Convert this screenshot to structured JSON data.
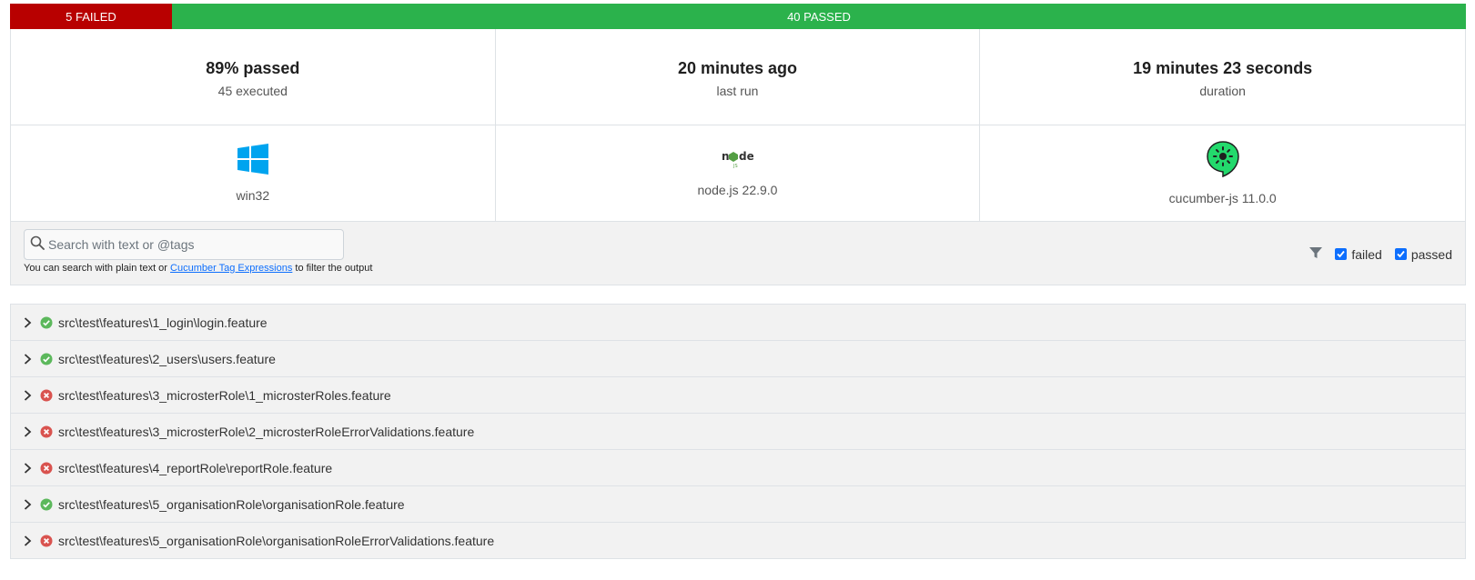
{
  "summary": {
    "failed_label": "5 FAILED",
    "passed_label": "40 PASSED",
    "failed_count": 5,
    "passed_count": 40,
    "failed_color": "#b80000",
    "passed_color": "#2bb24c"
  },
  "stats": [
    {
      "value": "89% passed",
      "label": "45 executed"
    },
    {
      "value": "20 minutes ago",
      "label": "last run"
    },
    {
      "value": "19 minutes 23 seconds",
      "label": "duration"
    }
  ],
  "environment": [
    {
      "icon": "windows-icon",
      "label": "win32"
    },
    {
      "icon": "nodejs-icon",
      "label": "node.js 22.9.0"
    },
    {
      "icon": "cucumber-icon",
      "label": "cucumber-js 11.0.0"
    }
  ],
  "search": {
    "placeholder": "Search with text or @tags",
    "value": "",
    "help_prefix": "You can search with plain text or ",
    "help_link": "Cucumber Tag Expressions",
    "help_suffix": " to filter the output"
  },
  "filters": {
    "icon": "filter-icon",
    "failed_label": "failed",
    "passed_label": "passed",
    "failed_checked": true,
    "passed_checked": true
  },
  "features": [
    {
      "path": "src\\test\\features\\1_login\\login.feature",
      "status": "passed"
    },
    {
      "path": "src\\test\\features\\2_users\\users.feature",
      "status": "passed"
    },
    {
      "path": "src\\test\\features\\3_microsterRole\\1_microsterRoles.feature",
      "status": "failed"
    },
    {
      "path": "src\\test\\features\\3_microsterRole\\2_microsterRoleErrorValidations.feature",
      "status": "failed"
    },
    {
      "path": "src\\test\\features\\4_reportRole\\reportRole.feature",
      "status": "failed"
    },
    {
      "path": "src\\test\\features\\5_organisationRole\\organisationRole.feature",
      "status": "passed"
    },
    {
      "path": "src\\test\\features\\5_organisationRole\\organisationRoleErrorValidations.feature",
      "status": "failed"
    }
  ]
}
